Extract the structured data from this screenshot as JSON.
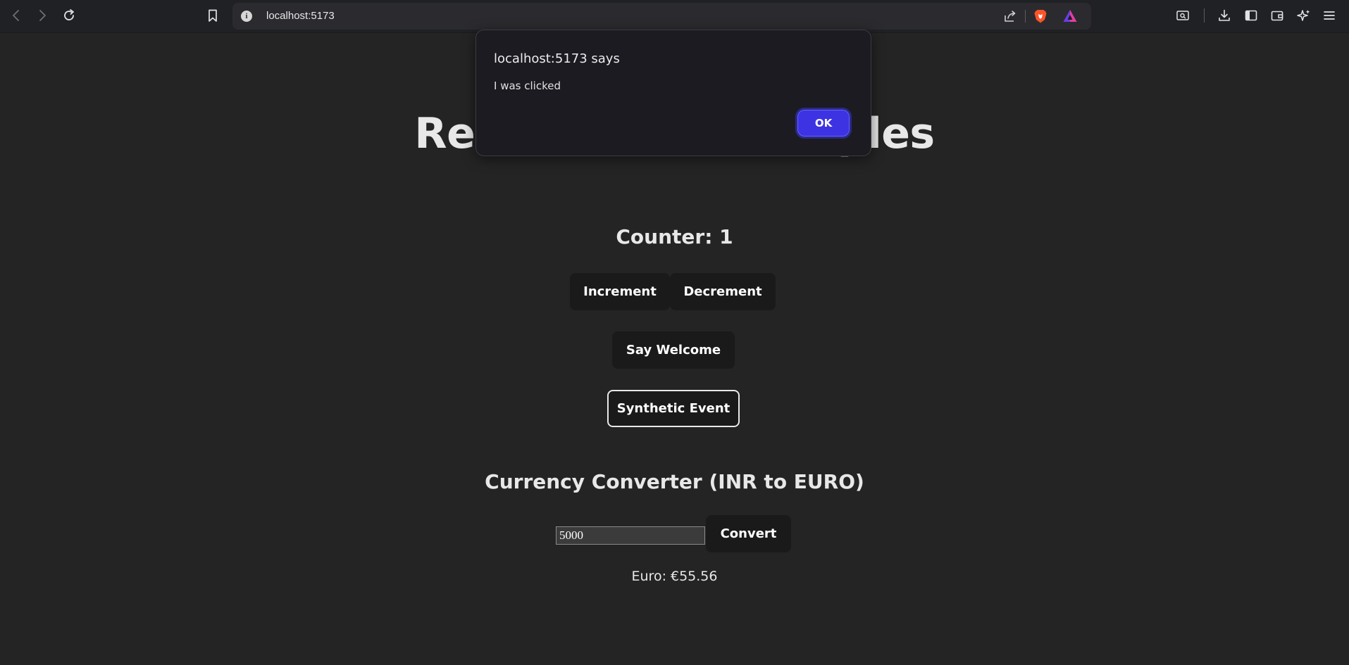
{
  "browser": {
    "url": "localhost:5173",
    "icons": [
      "back-icon",
      "forward-icon",
      "reload-icon",
      "bookmark-icon",
      "site-info-icon",
      "share-icon",
      "brave-shields-icon",
      "brave-rewards-icon",
      "search-tabs-icon",
      "downloads-icon",
      "sidebar-icon",
      "wallet-icon",
      "leo-ai-icon",
      "menu-icon"
    ],
    "accent_colors": {
      "brave": "#fb542b",
      "rewards": "#6b3ee6"
    }
  },
  "page": {
    "title": "React Event Examples",
    "counter_text": "Counter: 1",
    "buttons": {
      "increment": "Increment",
      "decrement": "Decrement",
      "say_welcome": "Say Welcome",
      "synthetic_event": "Synthetic Event",
      "convert": "Convert"
    },
    "currency": {
      "title": "Currency Converter (INR to EURO)",
      "amount": "5000",
      "result": "Euro: €55.56"
    }
  },
  "dialog": {
    "origin": "localhost:5173 says",
    "message": "I was clicked",
    "ok_label": "OK",
    "ok_color": "#3e33e2"
  }
}
